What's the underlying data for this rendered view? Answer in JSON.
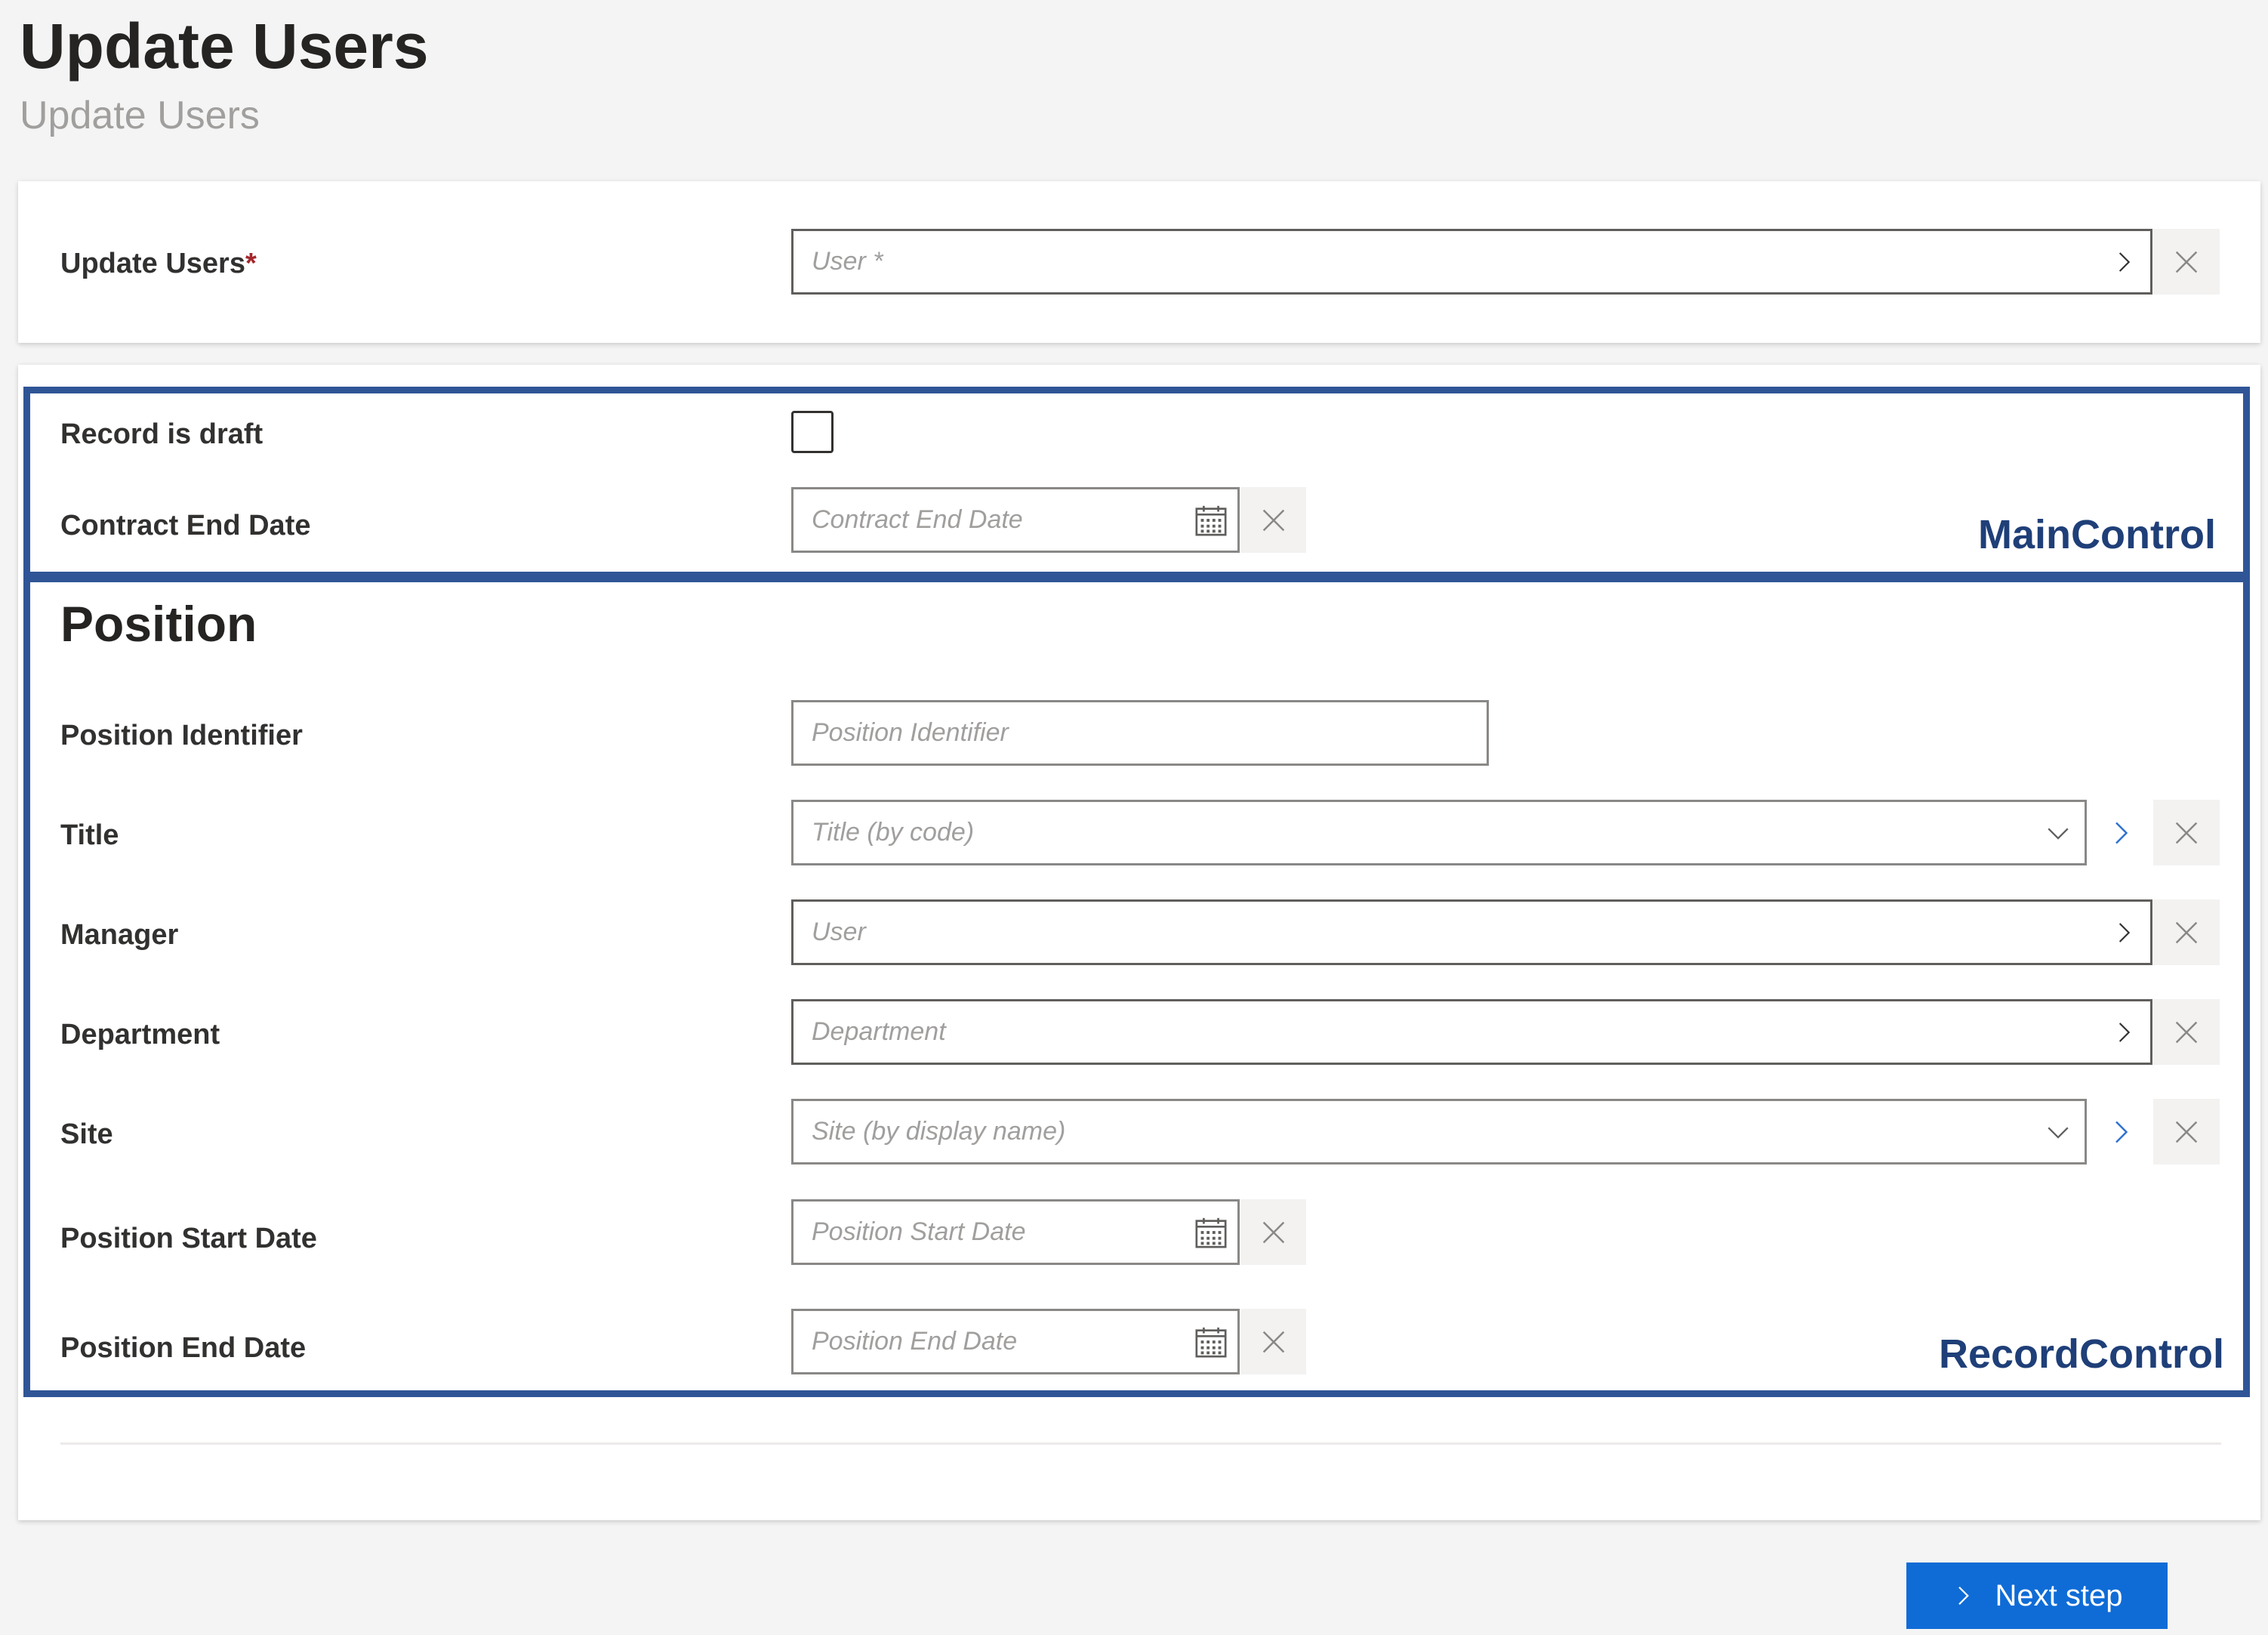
{
  "page": {
    "title": "Update Users",
    "subtitle": "Update Users"
  },
  "main_field": {
    "label": "Update Users",
    "required_mark": "*",
    "placeholder": "User *"
  },
  "main_control": {
    "annotation": "MainControl",
    "record_is_draft_label": "Record is draft",
    "record_is_draft_checked": false,
    "contract_end_date_label": "Contract End Date",
    "contract_end_date_placeholder": "Contract End Date"
  },
  "record_control": {
    "annotation": "RecordControl",
    "section_title": "Position",
    "position_identifier_label": "Position Identifier",
    "position_identifier_placeholder": "Position Identifier",
    "title_label": "Title",
    "title_placeholder": "Title (by code)",
    "manager_label": "Manager",
    "manager_placeholder": "User",
    "department_label": "Department",
    "department_placeholder": "Department",
    "site_label": "Site",
    "site_placeholder": "Site (by display name)",
    "position_start_date_label": "Position Start Date",
    "position_start_date_placeholder": "Position Start Date",
    "position_end_date_label": "Position End Date",
    "position_end_date_placeholder": "Position End Date"
  },
  "footer": {
    "next_step_label": "Next step"
  },
  "colors": {
    "primary_button": "#0f6cd6",
    "annotation_border": "#2f5597",
    "nav_chevron_blue": "#2b6fd0"
  },
  "icons": [
    "chevron-right-icon",
    "close-icon",
    "calendar-icon",
    "chevron-down-icon"
  ]
}
